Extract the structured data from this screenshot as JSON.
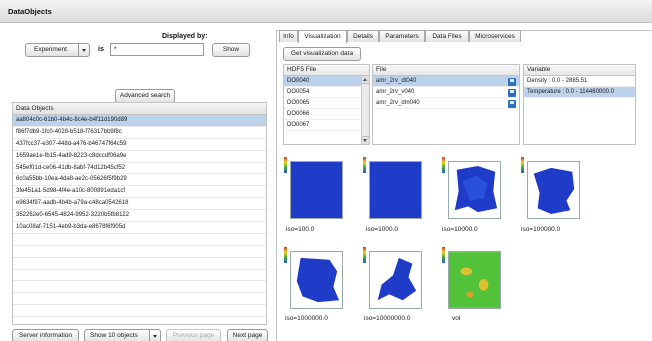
{
  "app": {
    "title": "DataObjects"
  },
  "search": {
    "displayed_by_label": "Displayed by:",
    "type_select": "Experiment",
    "is_label": "is",
    "query_value": "*",
    "show_button": "Show",
    "advanced_button": "Advanced search"
  },
  "data_objects": {
    "header": "Data Objects",
    "items": [
      "aa804c0c-61b0-4b4c-8c4e-b4f11d190d89",
      "f86f7db9-1fc0-4028-b518-f76317bb9f8c",
      "437fcc37-e307-448d-a476-b46747f64c59",
      "1659ae1e-fb15-4ad9-8223-c8dccdf06a9e",
      "545ef01d-ce06-41db-8abf-74d12b45cf52",
      "6c0a55bb-10ea-4da8-ae2c-05626f5f9b29",
      "3fe451a1-5d98-4f4e-a10c-800891eda1cf",
      "e9634f97-aadb-4b4b-a79a-c48ca0542618",
      "352262e0-6545-4824-9952-3220b5fb8122",
      "10ac08af-7151-4eb9-b3da-e8678f6f905d"
    ]
  },
  "pager": {
    "server_info": "Server information",
    "show_objects": "Show 10 objects",
    "prev_page": "Previous page",
    "next_page": "Next page"
  },
  "tabs": [
    "Info",
    "Visualization",
    "Details",
    "Parameters",
    "Data Files",
    "Microservices"
  ],
  "visualization": {
    "get_button": "Get visualization data",
    "hdf5_header": "HDF5 File",
    "hdf5_files": [
      "DO0040",
      "DO0054",
      "DO0065",
      "DO0066",
      "DO0067"
    ],
    "file_header": "File",
    "files": [
      "amr_2rv_dt040",
      "amr_2rv_v040",
      "amr_2rv_dm040"
    ],
    "variable_header": "Variable",
    "variables": [
      "Density : 0.0 - 2885.51",
      "Temperature : 0.0 - 114460000.0"
    ],
    "thumbnails": [
      "iso=100.0",
      "iso=1000.0",
      "iso=10000.0",
      "iso=100000.0",
      "iso=1000000.0",
      "iso=10000000.0",
      "vol"
    ]
  },
  "colors": {
    "selected_row": "#bcd2ea",
    "plot_blue": "#1f3cc8",
    "plot_green": "#52c23a"
  }
}
